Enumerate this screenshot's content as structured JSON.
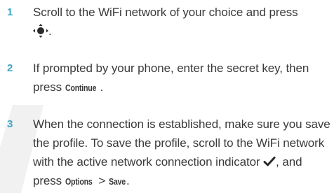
{
  "steps": [
    {
      "number": "1",
      "text_before": "Scroll to the WiFi network of your choice and press",
      "icon": "nav-center-key-icon",
      "text_after": "."
    },
    {
      "number": "2",
      "text_before": "If prompted by your phone, enter the secret key, then press ",
      "command": "Continue",
      "text_after": "."
    },
    {
      "number": "3",
      "text_before": "When the connection is established, make sure you save the profile. To save the profile, scroll to the WiFi network with the active network connection indicator ",
      "icon": "checkmark-icon",
      "text_middle": ", and press ",
      "command_1": "Options",
      "separator": " > ",
      "command_2": "Save",
      "text_after": "."
    }
  ],
  "colors": {
    "step_number": "#3fa6c6",
    "body_text": "#3a3a3a",
    "watermark": "#f0f0f0"
  }
}
